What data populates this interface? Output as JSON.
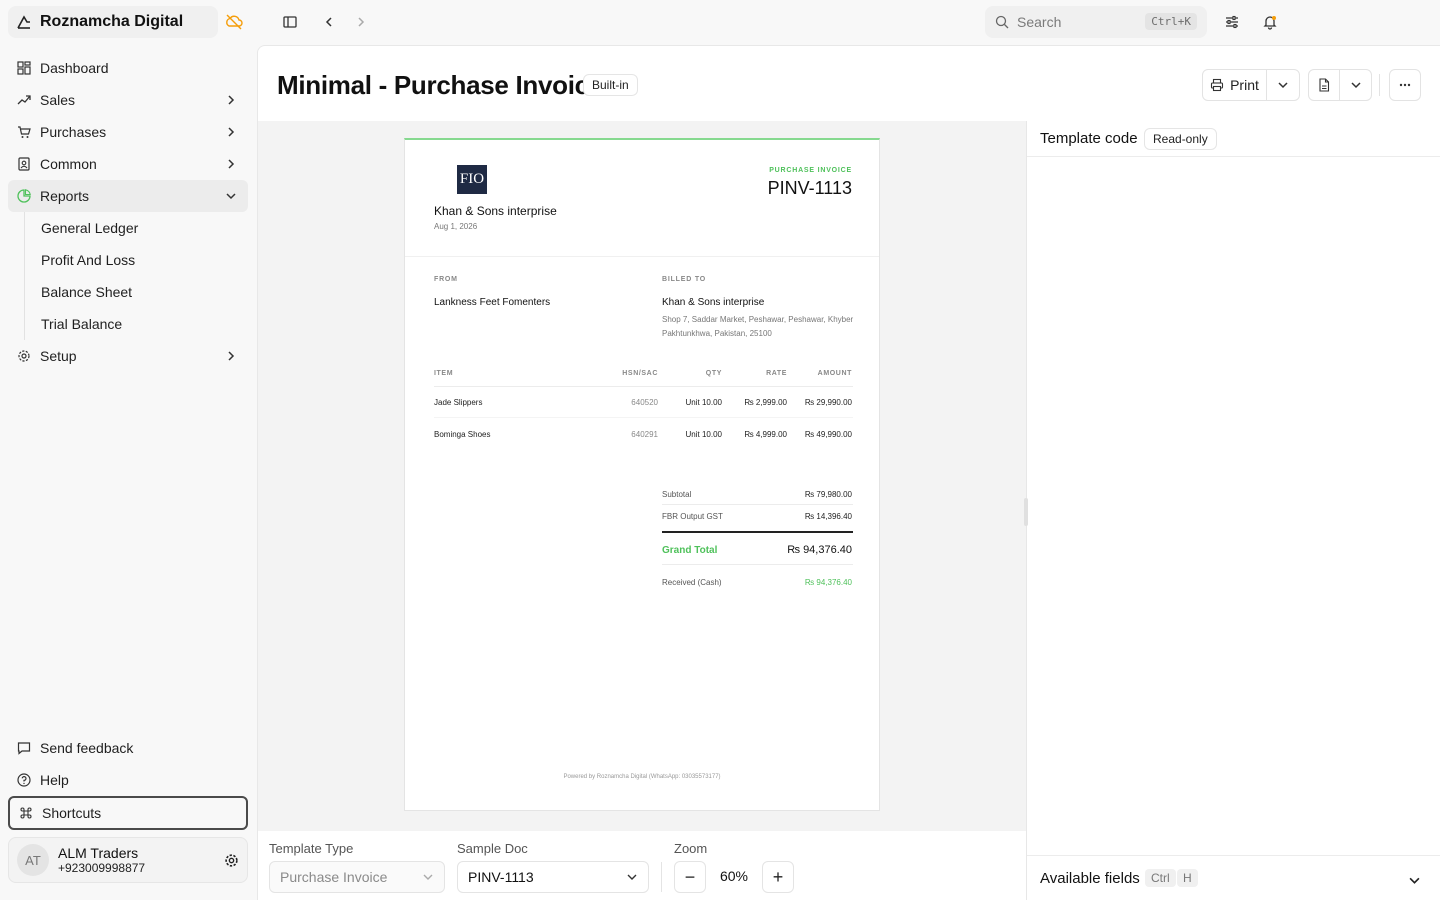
{
  "app": {
    "name": "Roznamcha Digital"
  },
  "search": {
    "placeholder": "Search",
    "shortcut": "Ctrl+K"
  },
  "sidebar": {
    "items": [
      {
        "label": "Dashboard"
      },
      {
        "label": "Sales"
      },
      {
        "label": "Purchases"
      },
      {
        "label": "Common"
      },
      {
        "label": "Reports"
      },
      {
        "label": "Setup"
      }
    ],
    "reports_sub": [
      "General Ledger",
      "Profit And Loss",
      "Balance Sheet",
      "Trial Balance"
    ],
    "footer": {
      "feedback": "Send feedback",
      "help": "Help",
      "shortcuts": "Shortcuts"
    },
    "user": {
      "initials": "AT",
      "name": "ALM Traders",
      "phone": "+923009998877"
    }
  },
  "page": {
    "title": "Minimal - Purchase Invoice",
    "badge": "Built-in",
    "print_label": "Print"
  },
  "invoice": {
    "logo_text": "FIO",
    "company": "Khan & Sons interprise",
    "date": "Aug 1, 2026",
    "doc_label": "PURCHASE INVOICE",
    "doc_no": "PINV-1113",
    "from_label": "FROM",
    "from_name": "Lankness Feet Fomenters",
    "billed_label": "BILLED TO",
    "billed_name": "Khan & Sons interprise",
    "billed_addr": "Shop 7, Saddar Market, Peshawar, Peshawar, Khyber Pakhtunkhwa, Pakistan, 25100",
    "columns": [
      "ITEM",
      "HSN/SAC",
      "QTY",
      "RATE",
      "AMOUNT"
    ],
    "rows": [
      {
        "item": "Jade Slippers",
        "hsn": "640520",
        "qty": "Unit 10.00",
        "rate": "₨ 2,999.00",
        "amount": "₨ 29,990.00"
      },
      {
        "item": "Bominga Shoes",
        "hsn": "640291",
        "qty": "Unit 10.00",
        "rate": "₨ 4,999.00",
        "amount": "₨ 49,990.00"
      }
    ],
    "subtotal_label": "Subtotal",
    "subtotal": "₨ 79,980.00",
    "tax_label": "FBR Output GST",
    "tax": "₨ 14,396.40",
    "grand_label": "Grand Total",
    "grand": "₨ 94,376.40",
    "received_label": "Received (Cash)",
    "received": "₨ 94,376.40",
    "powered": "Powered by Roznamcha Digital (WhatsApp: 03035573177)"
  },
  "controls": {
    "template_type_label": "Template Type",
    "template_type_value": "Purchase Invoice",
    "sample_doc_label": "Sample Doc",
    "sample_doc_value": "PINV-1113",
    "zoom_label": "Zoom",
    "zoom_value": "60%"
  },
  "right": {
    "template_code": "Template code",
    "read_only": "Read-only",
    "available_fields": "Available fields",
    "kbd_ctrl": "Ctrl",
    "kbd_h": "H"
  },
  "colors": {
    "accent_green": "#4fc15b",
    "warning_orange": "#f59e0b"
  }
}
